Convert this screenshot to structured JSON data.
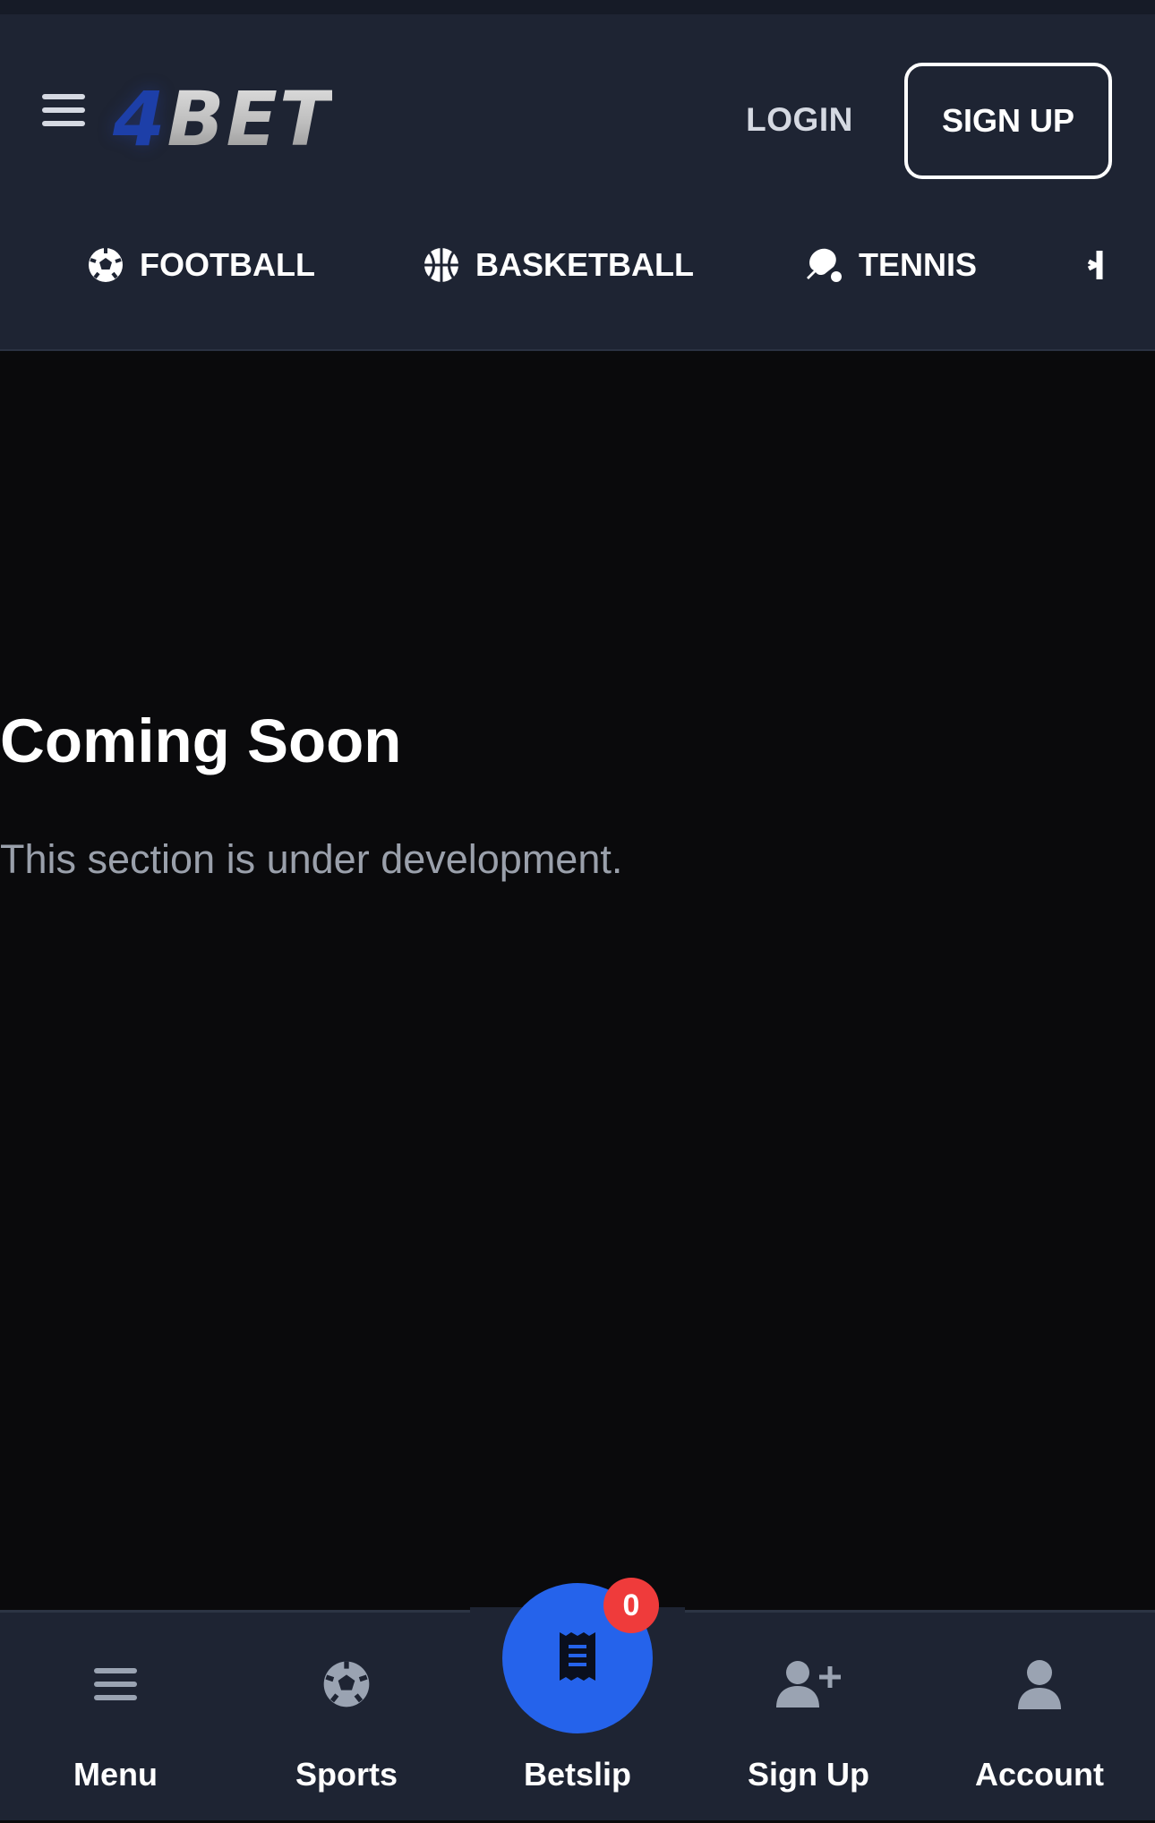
{
  "header": {
    "logo": {
      "prefix": "4",
      "name": "BET"
    },
    "login_label": "LOGIN",
    "signup_label": "SIGN UP"
  },
  "sports_nav": {
    "items": [
      {
        "label": "FOOTBALL",
        "icon": "football-icon"
      },
      {
        "label": "BASKETBALL",
        "icon": "basketball-icon"
      },
      {
        "label": "TENNIS",
        "icon": "table-tennis-icon"
      },
      {
        "label": "",
        "icon": "hockey-icon"
      }
    ]
  },
  "main": {
    "title": "Coming Soon",
    "subtitle": "This section is under development."
  },
  "bottom_nav": {
    "items": [
      {
        "label": "Menu",
        "icon": "menu-icon"
      },
      {
        "label": "Sports",
        "icon": "football-icon"
      },
      {
        "label": "Betslip",
        "icon": "receipt-icon"
      },
      {
        "label": "Sign Up",
        "icon": "user-plus-icon"
      },
      {
        "label": "Account",
        "icon": "user-icon"
      }
    ],
    "betslip_count": "0"
  },
  "colors": {
    "header_bg": "#1e2433",
    "content_bg": "#0a0a0c",
    "accent": "#2563eb",
    "badge": "#ef3b3b"
  }
}
